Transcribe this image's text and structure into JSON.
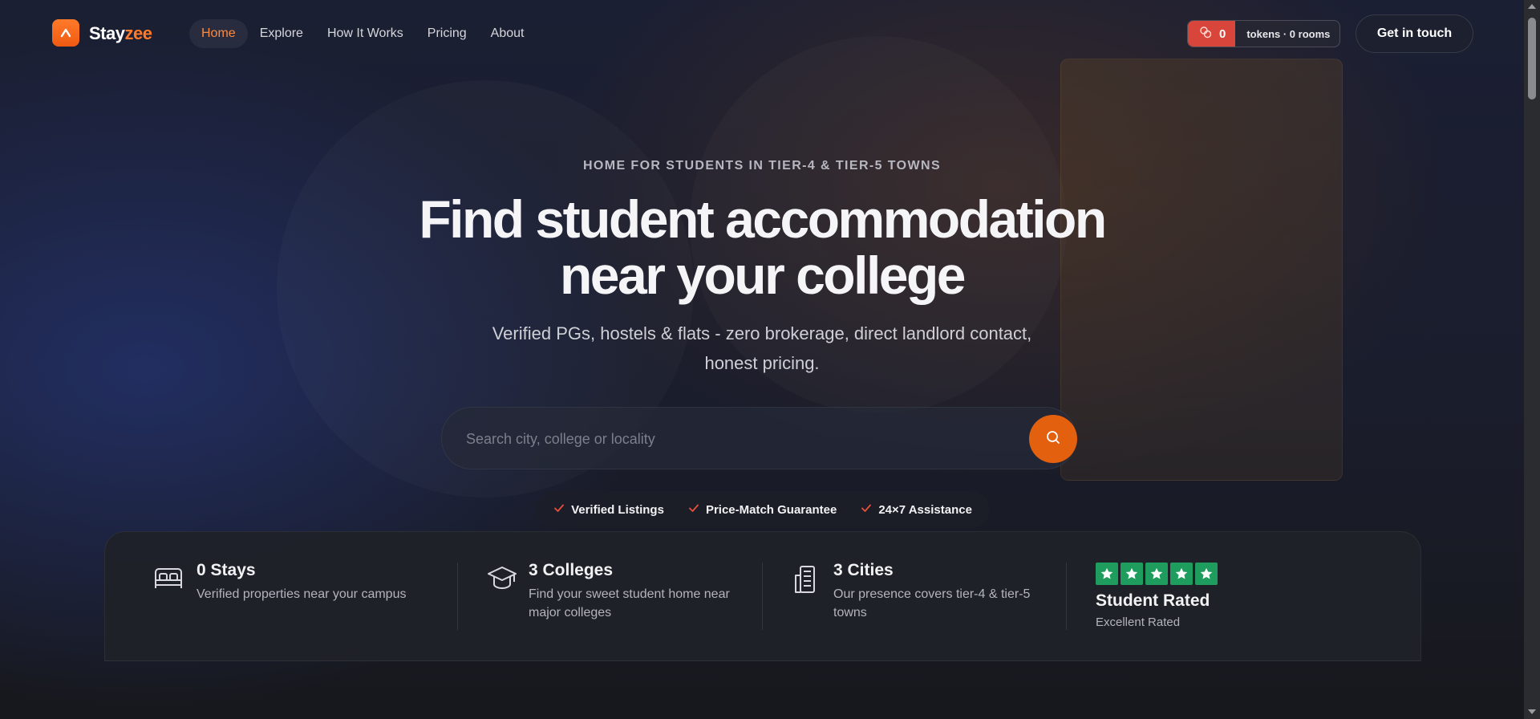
{
  "brand": {
    "name_part1": "Stay",
    "name_part2": "zee",
    "accent": "#ff7a2a"
  },
  "nav": {
    "links": [
      {
        "label": "Home",
        "active": true
      },
      {
        "label": "Explore",
        "active": false
      },
      {
        "label": "How It Works",
        "active": false
      },
      {
        "label": "Pricing",
        "active": false
      },
      {
        "label": "About",
        "active": false
      }
    ],
    "tokens": {
      "count": "0",
      "label": "tokens · 0 rooms",
      "color": "#d8453a"
    },
    "cta_label": "Get in touch"
  },
  "hero": {
    "eyebrow": "HOME FOR STUDENTS IN TIER-4 & TIER-5 TOWNS",
    "headline_line1": "Find student accommodation",
    "headline_line2": "near your college",
    "subhead": "Verified PGs, hostels & flats - zero brokerage, direct landlord contact, honest pricing.",
    "search_placeholder": "Search city, college or locality",
    "search_button_color": "#e3600f",
    "badges": [
      "Verified Listings",
      "Price-Match Guarantee",
      "24×7 Assistance"
    ]
  },
  "stats": [
    {
      "icon": "bed-icon",
      "title": "0 Stays",
      "desc": "Verified properties near your campus"
    },
    {
      "icon": "graduation-cap-icon",
      "title": "3 Colleges",
      "desc": "Find your sweet student home near major colleges"
    },
    {
      "icon": "building-icon",
      "title": "3 Cities",
      "desc": "Our presence covers tier-4 & tier-5 towns"
    }
  ],
  "rating": {
    "stars": 5,
    "star_color": "#1f9d5e",
    "title": "Student Rated",
    "desc": "Excellent Rated"
  }
}
